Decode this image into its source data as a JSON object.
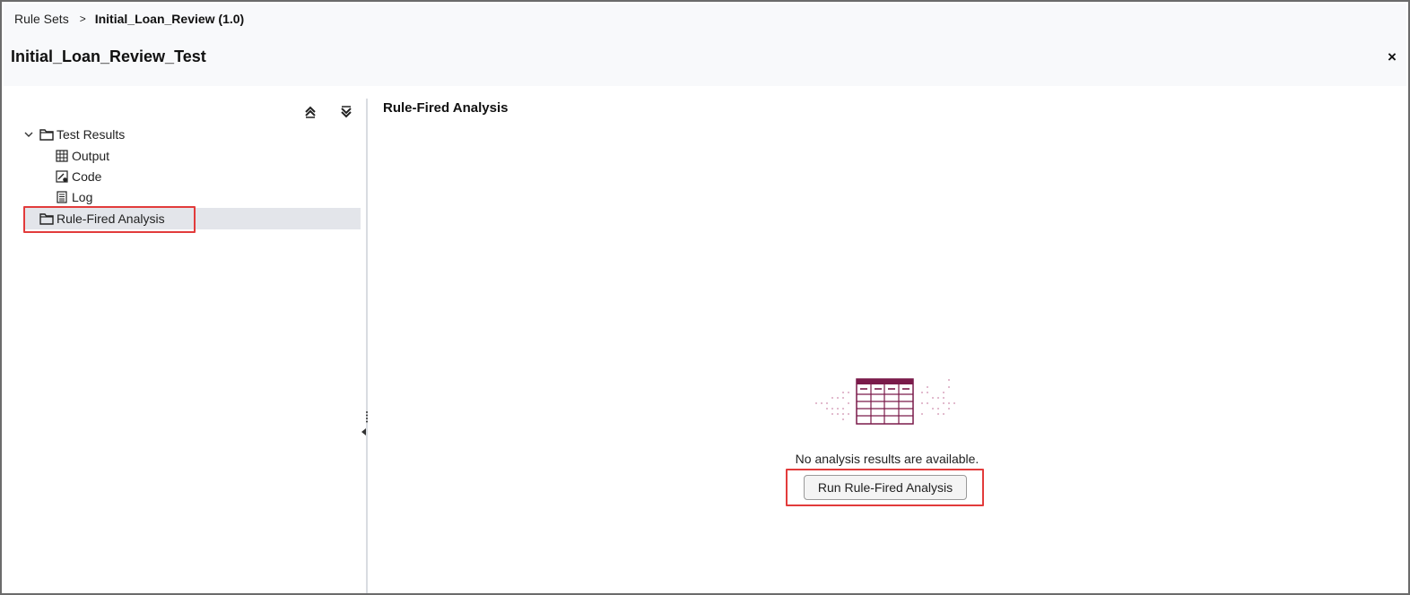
{
  "breadcrumb": {
    "parent": "Rule Sets",
    "separator": ">",
    "current": "Initial_Loan_Review (1.0)"
  },
  "header": {
    "title": "Initial_Loan_Review_Test",
    "close_label": "×"
  },
  "tree": {
    "toolbar": {
      "collapse_icon": "collapse-all-icon",
      "expand_icon": "expand-all-icon"
    },
    "items": [
      {
        "label": "Test Results",
        "icon": "folder-icon",
        "expanded": true,
        "children": [
          {
            "label": "Output",
            "icon": "table-grid-icon"
          },
          {
            "label": "Code",
            "icon": "code-edit-icon"
          },
          {
            "label": "Log",
            "icon": "log-document-icon"
          }
        ]
      },
      {
        "label": "Rule-Fired Analysis",
        "icon": "folder-icon",
        "selected": true
      }
    ]
  },
  "panel": {
    "title": "Rule-Fired Analysis",
    "empty_message": "No analysis results are available.",
    "run_button": "Run Rule-Fired Analysis"
  },
  "colors": {
    "highlight_outline": "#e23b3b",
    "accent": "#7a1a4a",
    "selected_row": "#e3e5ea"
  }
}
